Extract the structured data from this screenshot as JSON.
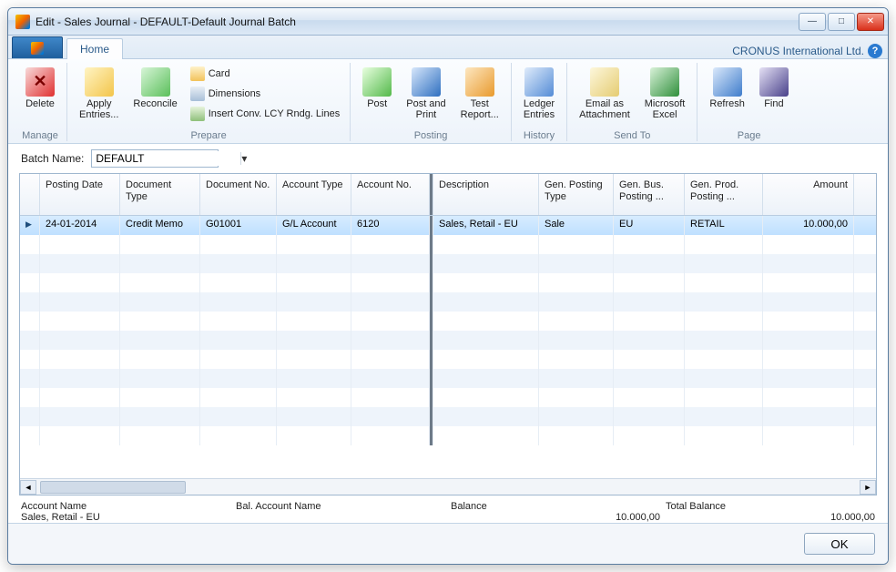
{
  "window": {
    "title": "Edit - Sales Journal - DEFAULT-Default Journal Batch"
  },
  "company": "CRONUS International Ltd.",
  "tabs": {
    "home": "Home"
  },
  "ribbon": {
    "manage": {
      "label": "Manage",
      "delete": "Delete"
    },
    "prepare": {
      "label": "Prepare",
      "apply": "Apply\nEntries...",
      "reconcile": "Reconcile",
      "card": "Card",
      "dimensions": "Dimensions",
      "insert": "Insert Conv. LCY Rndg. Lines"
    },
    "posting": {
      "label": "Posting",
      "post": "Post",
      "postprint": "Post and\nPrint",
      "test": "Test\nReport..."
    },
    "history": {
      "label": "History",
      "ledger": "Ledger\nEntries"
    },
    "sendto": {
      "label": "Send To",
      "email": "Email as\nAttachment",
      "excel": "Microsoft\nExcel"
    },
    "page": {
      "label": "Page",
      "refresh": "Refresh",
      "find": "Find"
    }
  },
  "batch": {
    "label": "Batch Name:",
    "value": "DEFAULT"
  },
  "grid": {
    "headers": {
      "posting_date": "Posting Date",
      "doc_type": "Document Type",
      "doc_no": "Document No.",
      "acc_type": "Account Type",
      "acc_no": "Account No.",
      "description": "Description",
      "gen_posting_type": "Gen. Posting Type",
      "gen_bus": "Gen. Bus. Posting ...",
      "gen_prod": "Gen. Prod. Posting ...",
      "amount": "Amount"
    },
    "rows": [
      {
        "posting_date": "24-01-2014",
        "doc_type": "Credit Memo",
        "doc_no": "G01001",
        "acc_type": "G/L Account",
        "acc_no": "6120",
        "description": "Sales, Retail - EU",
        "gen_posting_type": "Sale",
        "gen_bus": "EU",
        "gen_prod": "RETAIL",
        "amount": "10.000,00"
      }
    ]
  },
  "summary": {
    "account_name_label": "Account Name",
    "account_name_value": "Sales, Retail - EU",
    "bal_account_name_label": "Bal. Account Name",
    "bal_account_name_value": "",
    "balance_label": "Balance",
    "balance_value": "10.000,00",
    "total_balance_label": "Total Balance",
    "total_balance_value": "10.000,00"
  },
  "footer": {
    "ok": "OK"
  }
}
